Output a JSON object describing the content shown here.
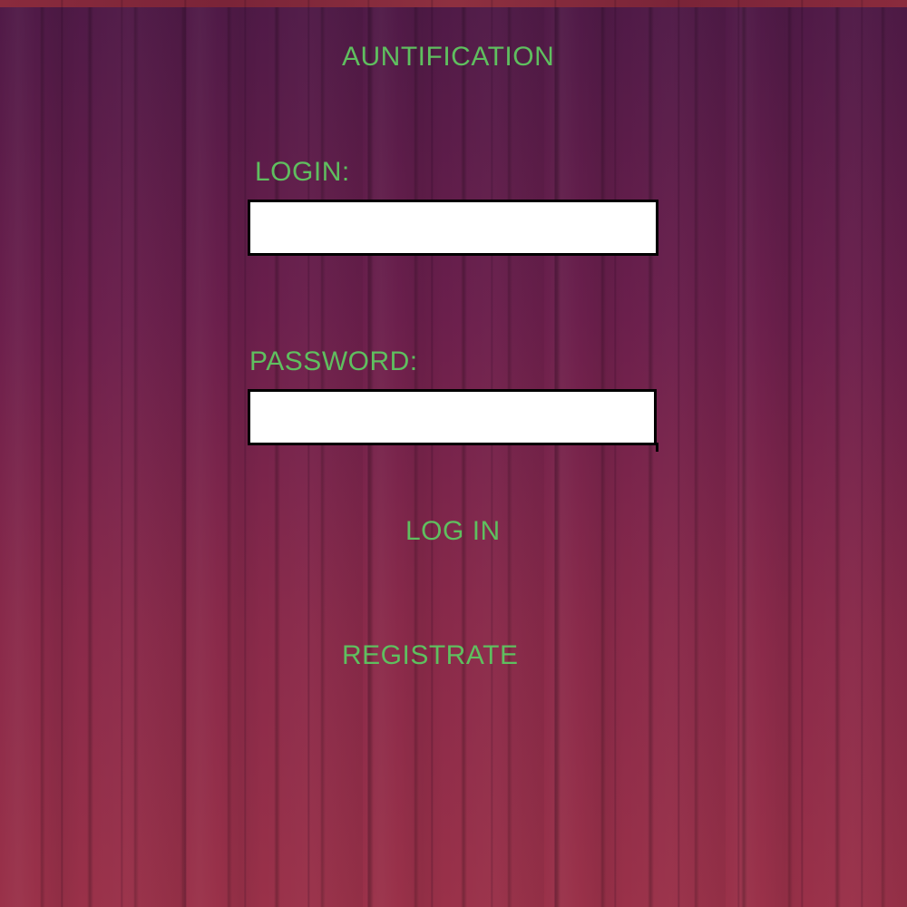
{
  "title": "AUNTIFICATION",
  "form": {
    "login_label": "LOGIN:",
    "login_value": "",
    "password_label": "PASSWORD:",
    "password_value": "",
    "login_button": "LOG IN",
    "register_link": "REGISTRATE"
  },
  "colors": {
    "text_accent": "#5fbf5f",
    "field_background": "#ffffff",
    "field_border": "#000000",
    "background_top": "#4f1a47",
    "background_bottom": "#9a3149"
  }
}
